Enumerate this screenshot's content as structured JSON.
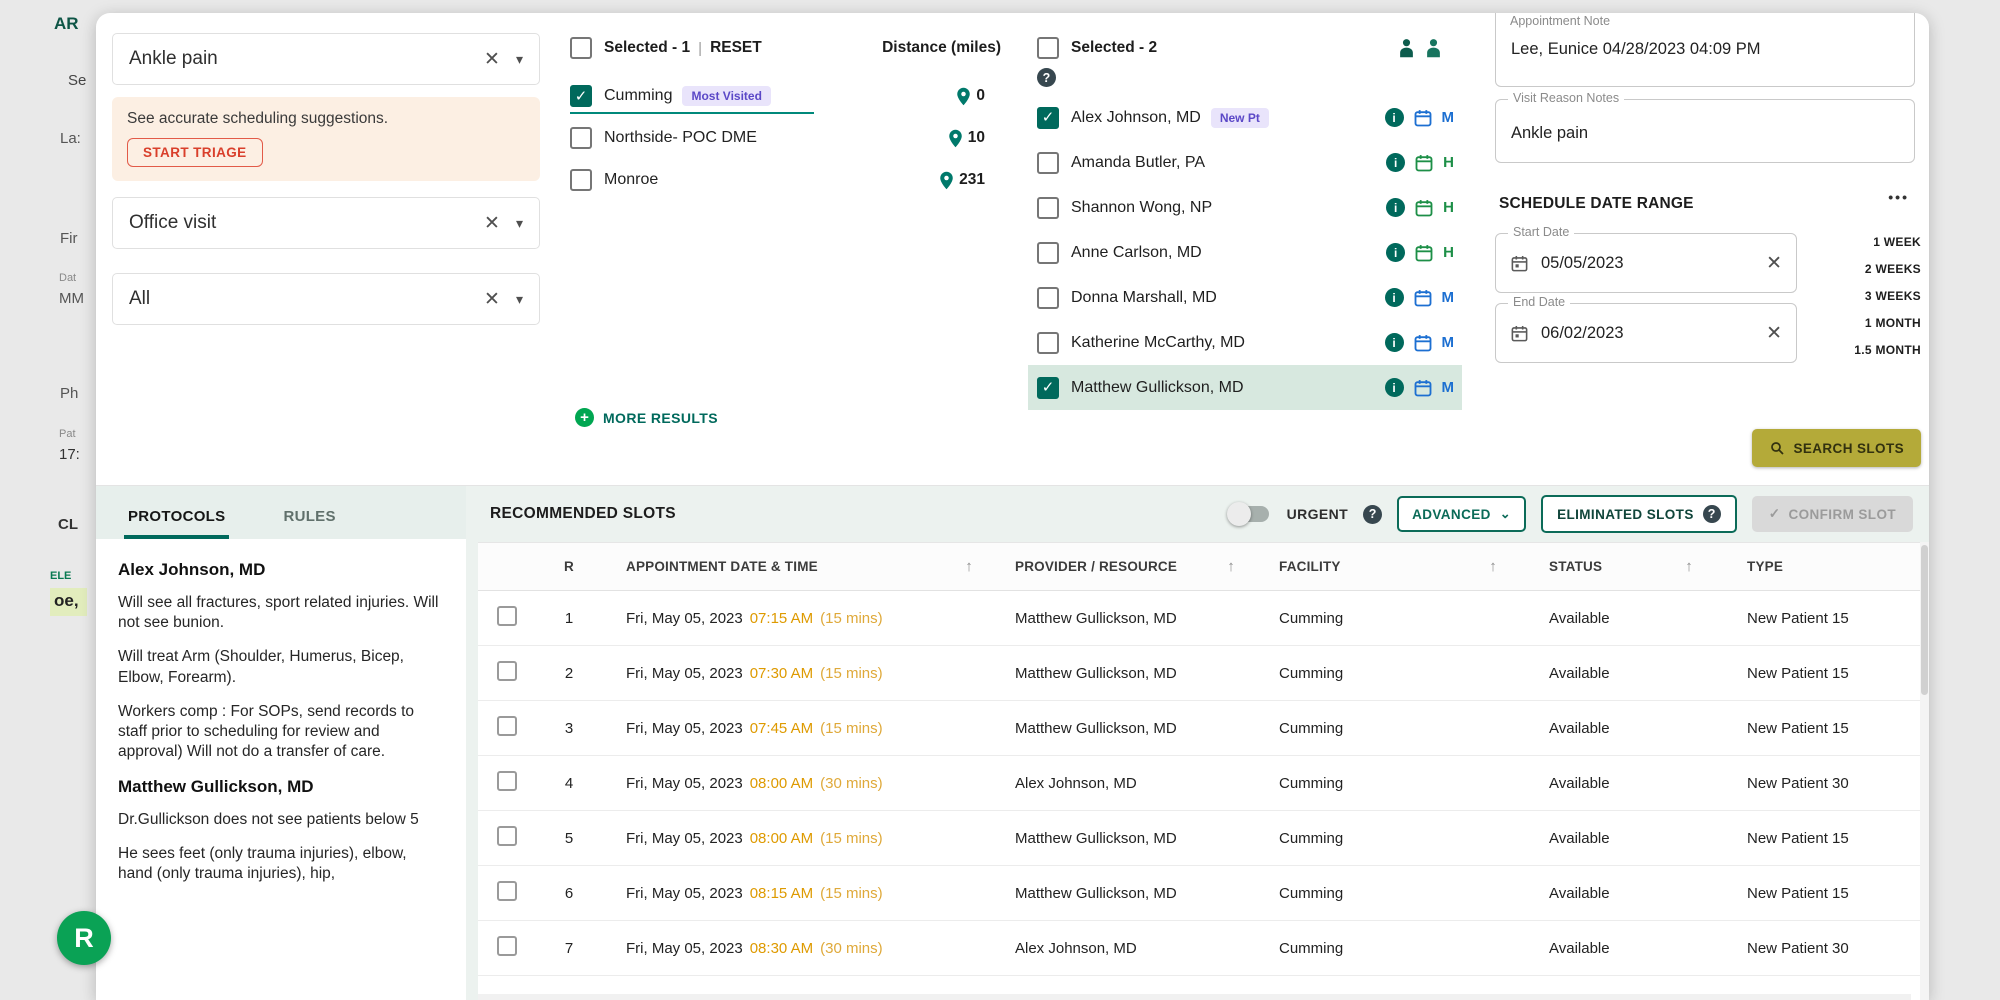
{
  "icons": {
    "close": "✕",
    "caret_down": "▾",
    "expand": "⌄",
    "overflow": "•••",
    "check": "✓",
    "plus": "+",
    "question": "?",
    "info": "i",
    "sort_asc": "↑",
    "pipe": "|"
  },
  "colors": {
    "accent_teal": "#00695c",
    "badge_purple_bg": "#e9e4fb",
    "badge_purple_text": "#5b48c7",
    "time_amber": "#de9a00",
    "notice_bg": "#fcefe3",
    "triage_red": "#d93f2b",
    "search_slots_olive": "#b4aa39",
    "row_highlight": "#d7e8df",
    "calendar_blue": "#1c6fd1",
    "calendar_green": "#1d8f47",
    "more_results_green": "#00a651",
    "fab_green": "#0aa255"
  },
  "background": {
    "logo_fragment": "AR",
    "fab_label": "R",
    "fragments": [
      "Se",
      "La:",
      "Fir",
      "Dat",
      "MM",
      "Ph",
      "Pat",
      "17:",
      "CL",
      "ELE",
      "oe,"
    ]
  },
  "filters": {
    "reason_value": "Ankle pain",
    "notice_text": "See accurate scheduling suggestions.",
    "triage_button": "START TRIAGE",
    "visit_type_value": "Office visit",
    "provider_filter_value": "All"
  },
  "facilities": {
    "selected_label": "Selected  - 1",
    "reset_label": "RESET",
    "distance_header": "Distance (miles)",
    "more_results_label": "MORE RESULTS",
    "items": [
      {
        "name": "Cumming",
        "badge": "Most Visited",
        "distance": "0",
        "checked": true
      },
      {
        "name": "Northside- POC DME",
        "distance": "10",
        "checked": false
      },
      {
        "name": "Monroe",
        "distance": "231",
        "checked": false
      }
    ]
  },
  "providers": {
    "selected_label": "Selected  - 2",
    "items": [
      {
        "name": "Alex Johnson, MD",
        "badge": "New Pt",
        "checked": true,
        "calendar": "M"
      },
      {
        "name": "Amanda Butler, PA",
        "checked": false,
        "calendar": "H"
      },
      {
        "name": "Shannon Wong, NP",
        "checked": false,
        "calendar": "H"
      },
      {
        "name": "Anne Carlson, MD",
        "checked": false,
        "calendar": "H"
      },
      {
        "name": "Donna Marshall, MD",
        "checked": false,
        "calendar": "M"
      },
      {
        "name": "Katherine McCarthy, MD",
        "checked": false,
        "calendar": "M"
      },
      {
        "name": "Matthew Gullickson, MD",
        "checked": true,
        "highlighted": true,
        "calendar": "M"
      }
    ]
  },
  "appointment": {
    "note_label": "Appointment Note",
    "note_value": "Lee, Eunice 04/28/2023 04:09 PM",
    "visit_reason_label": "Visit Reason Notes",
    "visit_reason_value": "Ankle pain",
    "date_range_title": "SCHEDULE DATE RANGE",
    "start_date_label": "Start Date",
    "start_date_value": "05/05/2023",
    "end_date_label": "End Date",
    "end_date_value": "06/02/2023",
    "quick_ranges": [
      "1 WEEK",
      "2 WEEKS",
      "3 WEEKS",
      "1 MONTH",
      "1.5 MONTH"
    ],
    "search_slots_button": "SEARCH SLOTS"
  },
  "protocols": {
    "tabs": [
      "PROTOCOLS",
      "RULES"
    ],
    "active_tab": "PROTOCOLS",
    "sections": [
      {
        "provider": "Alex Johnson, MD",
        "paragraphs": [
          "Will see all fractures, sport related injuries. Will not see bunion.",
          "Will treat Arm (Shoulder, Humerus, Bicep, Elbow, Forearm).",
          "Workers comp : For SOPs, send records to staff prior to scheduling for review and approval) Will not do a transfer of care."
        ]
      },
      {
        "provider": "Matthew Gullickson, MD",
        "paragraphs": [
          "Dr.Gullickson does not see patients below 5",
          "He sees feet (only trauma injuries), elbow, hand (only trauma injuries), hip,"
        ]
      }
    ]
  },
  "slots": {
    "title": "RECOMMENDED SLOTS",
    "urgent_label": "URGENT",
    "advanced_label": "ADVANCED",
    "eliminated_label": "ELIMINATED SLOTS",
    "confirm_label": "CONFIRM SLOT",
    "columns": {
      "r": "R",
      "datetime": "APPOINTMENT DATE & TIME",
      "provider": "PROVIDER / RESOURCE",
      "facility": "FACILITY",
      "status": "STATUS",
      "type": "TYPE"
    },
    "rows": [
      {
        "r": "1",
        "date": "Fri, May 05, 2023",
        "time": "07:15 AM",
        "duration": "(15 mins)",
        "provider": "Matthew Gullickson, MD",
        "facility": "Cumming",
        "status": "Available",
        "type": "New Patient 15"
      },
      {
        "r": "2",
        "date": "Fri, May 05, 2023",
        "time": "07:30 AM",
        "duration": "(15 mins)",
        "provider": "Matthew Gullickson, MD",
        "facility": "Cumming",
        "status": "Available",
        "type": "New Patient 15"
      },
      {
        "r": "3",
        "date": "Fri, May 05, 2023",
        "time": "07:45 AM",
        "duration": "(15 mins)",
        "provider": "Matthew Gullickson, MD",
        "facility": "Cumming",
        "status": "Available",
        "type": "New Patient 15"
      },
      {
        "r": "4",
        "date": "Fri, May 05, 2023",
        "time": "08:00 AM",
        "duration": "(30 mins)",
        "provider": "Alex Johnson, MD",
        "facility": "Cumming",
        "status": "Available",
        "type": "New Patient 30"
      },
      {
        "r": "5",
        "date": "Fri, May 05, 2023",
        "time": "08:00 AM",
        "duration": "(15 mins)",
        "provider": "Matthew Gullickson, MD",
        "facility": "Cumming",
        "status": "Available",
        "type": "New Patient 15"
      },
      {
        "r": "6",
        "date": "Fri, May 05, 2023",
        "time": "08:15 AM",
        "duration": "(15 mins)",
        "provider": "Matthew Gullickson, MD",
        "facility": "Cumming",
        "status": "Available",
        "type": "New Patient 15"
      },
      {
        "r": "7",
        "date": "Fri, May 05, 2023",
        "time": "08:30 AM",
        "duration": "(30 mins)",
        "provider": "Alex Johnson, MD",
        "facility": "Cumming",
        "status": "Available",
        "type": "New Patient 30"
      }
    ]
  }
}
